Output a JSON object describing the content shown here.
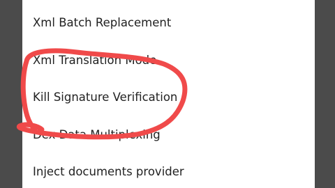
{
  "menu": {
    "items": [
      {
        "label": "Xml Batch Replacement"
      },
      {
        "label": "Xml Translation Mode"
      },
      {
        "label": "Kill Signature Verification"
      },
      {
        "label": "Dex Data Multiplexing"
      },
      {
        "label": "Inject documents provider"
      }
    ]
  },
  "annotation": {
    "color": "#f04a4a",
    "shape": "hand-drawn-circle"
  }
}
